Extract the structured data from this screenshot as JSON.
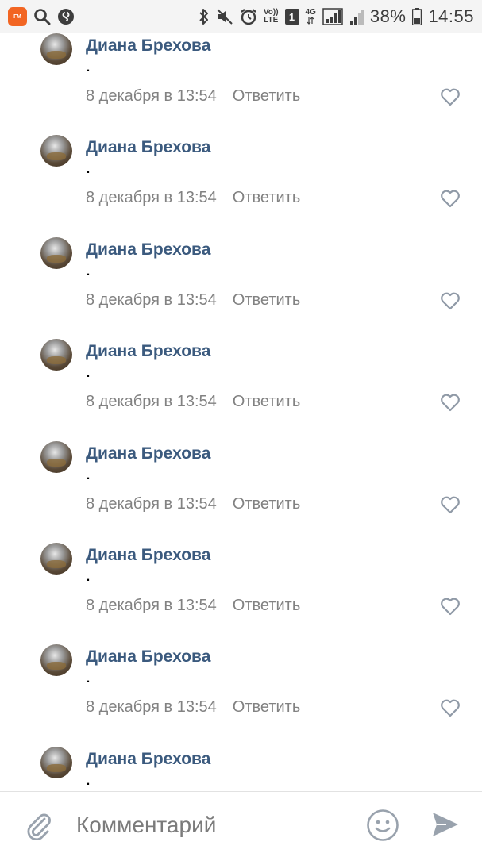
{
  "status_bar": {
    "app_badge": "ГМ",
    "network_type": "4G",
    "volte_top": "Vo))",
    "volte_bottom": "LTE",
    "sim_number": "1",
    "battery_percent": "38%",
    "time": "14:55"
  },
  "comments": [
    {
      "author": "Диана Брехова",
      "text": ".",
      "date": "8 декабря в 13:54",
      "reply_label": "Ответить"
    },
    {
      "author": "Диана Брехова",
      "text": ".",
      "date": "8 декабря в 13:54",
      "reply_label": "Ответить"
    },
    {
      "author": "Диана Брехова",
      "text": ".",
      "date": "8 декабря в 13:54",
      "reply_label": "Ответить"
    },
    {
      "author": "Диана Брехова",
      "text": ".",
      "date": "8 декабря в 13:54",
      "reply_label": "Ответить"
    },
    {
      "author": "Диана Брехова",
      "text": ".",
      "date": "8 декабря в 13:54",
      "reply_label": "Ответить"
    },
    {
      "author": "Диана Брехова",
      "text": ".",
      "date": "8 декабря в 13:54",
      "reply_label": "Ответить"
    },
    {
      "author": "Диана Брехова",
      "text": ".",
      "date": "8 декабря в 13:54",
      "reply_label": "Ответить"
    },
    {
      "author": "Диана Брехова",
      "text": "."
    }
  ],
  "composer": {
    "placeholder": "Комментарий"
  },
  "colors": {
    "author": "#3b5a7e",
    "meta": "#828282",
    "icons": "#8f99a6",
    "send": "#99a2ad"
  }
}
